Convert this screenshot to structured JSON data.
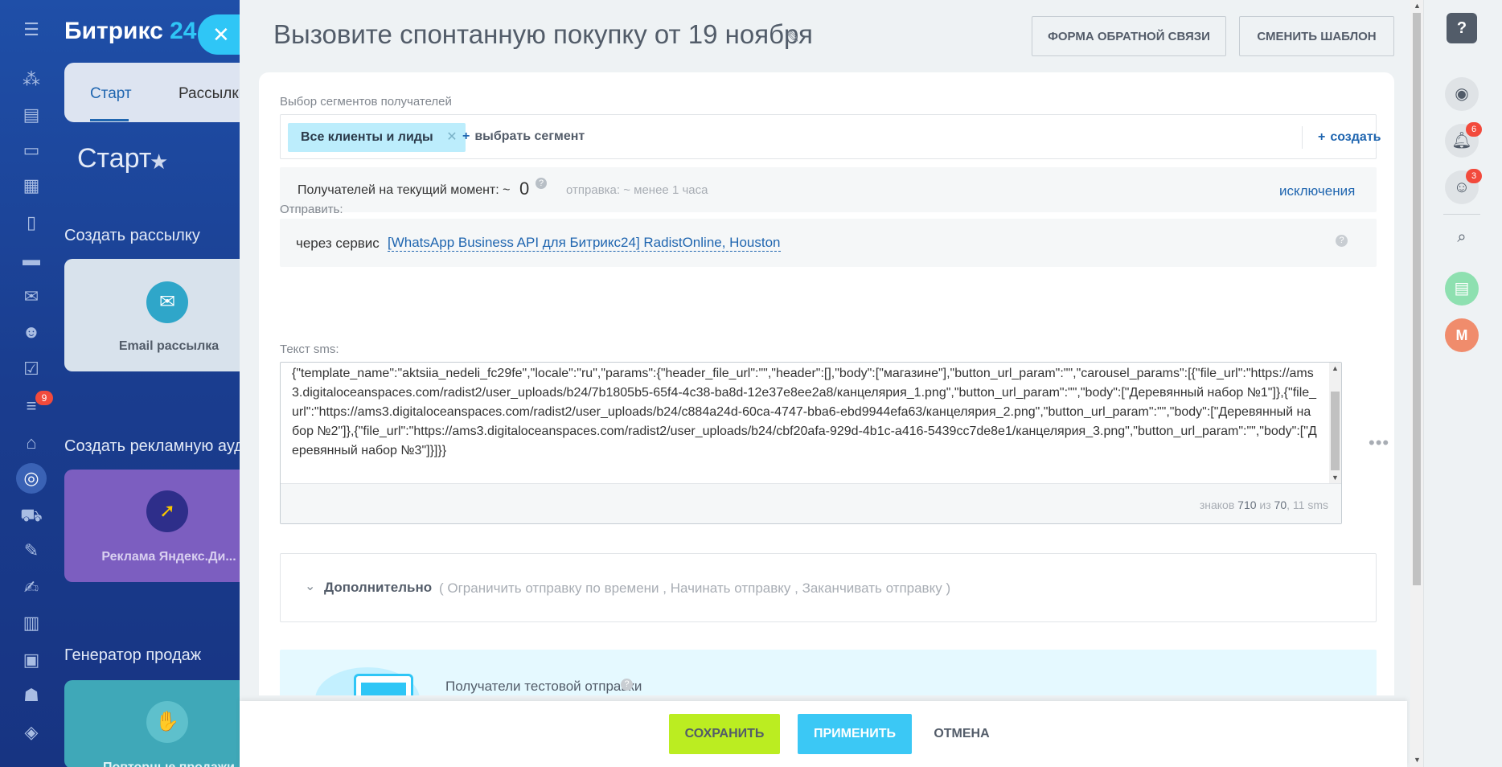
{
  "background": {
    "logo_text": "Битрикс",
    "logo_num": "24",
    "tabs": [
      "Старт",
      "Рассылки"
    ],
    "heading": "Старт",
    "sections": [
      "Создать рассылку",
      "Создать рекламную ауд",
      "Генератор продаж"
    ],
    "cards": [
      "Email рассылка",
      "Реклама Яндекс.Ди...",
      "Повторные продажи"
    ],
    "menu_badge": "9"
  },
  "panel": {
    "title": "Вызовите спонтанную покупку от 19 ноября",
    "btn_feedback": "ФОРМА ОБРАТНОЙ СВЯЗИ",
    "btn_template": "СМЕНИТЬ ШАБЛОН"
  },
  "segments": {
    "label": "Выбор сегментов получателей",
    "chip": "Все клиенты и лиды",
    "select": "выбрать сегмент",
    "create": "создать"
  },
  "recipients": {
    "label": "Получателей на текущий момент: ~",
    "count": "0",
    "eta": "отправка: ~ менее 1 часа",
    "exclusions": "исключения"
  },
  "send": {
    "label": "Отправить:",
    "via": "через сервис",
    "service": "[WhatsApp Business API для Битрикс24] RadistOnline, Houston"
  },
  "sms": {
    "label": "Текст sms:",
    "text": "{\"template_name\":\"aktsiia_nedeli_fc29fe\",\"locale\":\"ru\",\"params\":{\"header_file_url\":\"\",\"header\":[],\"body\":[\"магазине\"],\"button_url_param\":\"\",\"carousel_params\":[{\"file_url\":\"https://ams3.digitaloceanspaces.com/radist2/user_uploads/b24/7b1805b5-65f4-4c38-ba8d-12e37e8ee2a8/канцелярия_1.png\",\"button_url_param\":\"\",\"body\":[\"Деревянный набор №1\"]},{\"file_url\":\"https://ams3.digitaloceanspaces.com/radist2/user_uploads/b24/c884a24d-60ca-4747-bba6-ebd9944efa63/канцелярия_2.png\",\"button_url_param\":\"\",\"body\":[\"Деревянный набор №2\"]},{\"file_url\":\"https://ams3.digitaloceanspaces.com/radist2/user_uploads/b24/cbf20afa-929d-4b1c-a416-5439cc7de8e1/канцелярия_3.png\",\"button_url_param\":\"\",\"body\":[\"Деревянный набор №3\"]}]}}",
    "counter_prefix": "знаков",
    "counter_chars": "710",
    "counter_mid": "из",
    "counter_limit": "70",
    "counter_sms": ", 11 sms"
  },
  "extra": {
    "title": "Дополнительно",
    "options": "( Ограничить отправку по времени ,  Начинать отправку ,  Заканчивать отправку  )"
  },
  "test": {
    "label": "Получатели тестовой отправки"
  },
  "bottom": {
    "save": "СОХРАНИТЬ",
    "apply": "ПРИМЕНИТЬ",
    "cancel": "ОТМЕНА"
  },
  "right_bar": {
    "bell_badge": "6",
    "chat_badge": "3",
    "avatar": "M"
  },
  "colors": {
    "accent_blue": "#2066b0",
    "save_green": "#bbed21",
    "apply_cyan": "#3bc8f5",
    "badge_red": "#f24a3c"
  }
}
